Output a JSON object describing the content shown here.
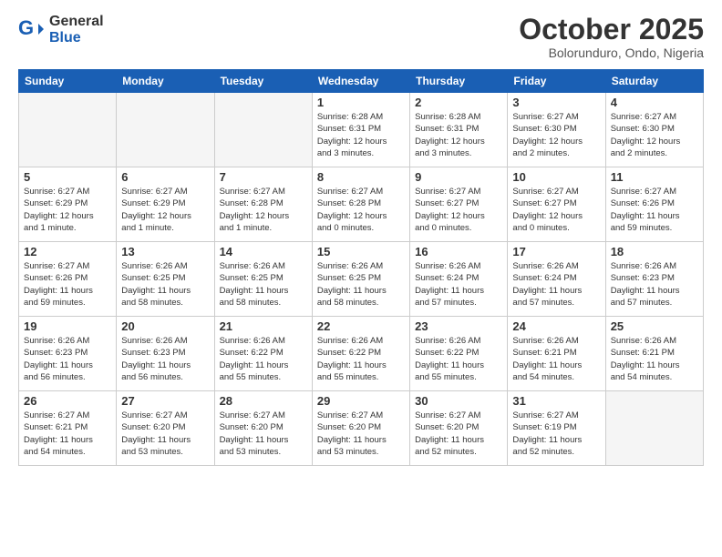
{
  "header": {
    "logo_general": "General",
    "logo_blue": "Blue",
    "month_title": "October 2025",
    "subtitle": "Bolorunduro, Ondo, Nigeria"
  },
  "calendar": {
    "days_of_week": [
      "Sunday",
      "Monday",
      "Tuesday",
      "Wednesday",
      "Thursday",
      "Friday",
      "Saturday"
    ],
    "weeks": [
      [
        {
          "day": "",
          "info": ""
        },
        {
          "day": "",
          "info": ""
        },
        {
          "day": "",
          "info": ""
        },
        {
          "day": "1",
          "info": "Sunrise: 6:28 AM\nSunset: 6:31 PM\nDaylight: 12 hours\nand 3 minutes."
        },
        {
          "day": "2",
          "info": "Sunrise: 6:28 AM\nSunset: 6:31 PM\nDaylight: 12 hours\nand 3 minutes."
        },
        {
          "day": "3",
          "info": "Sunrise: 6:27 AM\nSunset: 6:30 PM\nDaylight: 12 hours\nand 2 minutes."
        },
        {
          "day": "4",
          "info": "Sunrise: 6:27 AM\nSunset: 6:30 PM\nDaylight: 12 hours\nand 2 minutes."
        }
      ],
      [
        {
          "day": "5",
          "info": "Sunrise: 6:27 AM\nSunset: 6:29 PM\nDaylight: 12 hours\nand 1 minute."
        },
        {
          "day": "6",
          "info": "Sunrise: 6:27 AM\nSunset: 6:29 PM\nDaylight: 12 hours\nand 1 minute."
        },
        {
          "day": "7",
          "info": "Sunrise: 6:27 AM\nSunset: 6:28 PM\nDaylight: 12 hours\nand 1 minute."
        },
        {
          "day": "8",
          "info": "Sunrise: 6:27 AM\nSunset: 6:28 PM\nDaylight: 12 hours\nand 0 minutes."
        },
        {
          "day": "9",
          "info": "Sunrise: 6:27 AM\nSunset: 6:27 PM\nDaylight: 12 hours\nand 0 minutes."
        },
        {
          "day": "10",
          "info": "Sunrise: 6:27 AM\nSunset: 6:27 PM\nDaylight: 12 hours\nand 0 minutes."
        },
        {
          "day": "11",
          "info": "Sunrise: 6:27 AM\nSunset: 6:26 PM\nDaylight: 11 hours\nand 59 minutes."
        }
      ],
      [
        {
          "day": "12",
          "info": "Sunrise: 6:27 AM\nSunset: 6:26 PM\nDaylight: 11 hours\nand 59 minutes."
        },
        {
          "day": "13",
          "info": "Sunrise: 6:26 AM\nSunset: 6:25 PM\nDaylight: 11 hours\nand 58 minutes."
        },
        {
          "day": "14",
          "info": "Sunrise: 6:26 AM\nSunset: 6:25 PM\nDaylight: 11 hours\nand 58 minutes."
        },
        {
          "day": "15",
          "info": "Sunrise: 6:26 AM\nSunset: 6:25 PM\nDaylight: 11 hours\nand 58 minutes."
        },
        {
          "day": "16",
          "info": "Sunrise: 6:26 AM\nSunset: 6:24 PM\nDaylight: 11 hours\nand 57 minutes."
        },
        {
          "day": "17",
          "info": "Sunrise: 6:26 AM\nSunset: 6:24 PM\nDaylight: 11 hours\nand 57 minutes."
        },
        {
          "day": "18",
          "info": "Sunrise: 6:26 AM\nSunset: 6:23 PM\nDaylight: 11 hours\nand 57 minutes."
        }
      ],
      [
        {
          "day": "19",
          "info": "Sunrise: 6:26 AM\nSunset: 6:23 PM\nDaylight: 11 hours\nand 56 minutes."
        },
        {
          "day": "20",
          "info": "Sunrise: 6:26 AM\nSunset: 6:23 PM\nDaylight: 11 hours\nand 56 minutes."
        },
        {
          "day": "21",
          "info": "Sunrise: 6:26 AM\nSunset: 6:22 PM\nDaylight: 11 hours\nand 55 minutes."
        },
        {
          "day": "22",
          "info": "Sunrise: 6:26 AM\nSunset: 6:22 PM\nDaylight: 11 hours\nand 55 minutes."
        },
        {
          "day": "23",
          "info": "Sunrise: 6:26 AM\nSunset: 6:22 PM\nDaylight: 11 hours\nand 55 minutes."
        },
        {
          "day": "24",
          "info": "Sunrise: 6:26 AM\nSunset: 6:21 PM\nDaylight: 11 hours\nand 54 minutes."
        },
        {
          "day": "25",
          "info": "Sunrise: 6:26 AM\nSunset: 6:21 PM\nDaylight: 11 hours\nand 54 minutes."
        }
      ],
      [
        {
          "day": "26",
          "info": "Sunrise: 6:27 AM\nSunset: 6:21 PM\nDaylight: 11 hours\nand 54 minutes."
        },
        {
          "day": "27",
          "info": "Sunrise: 6:27 AM\nSunset: 6:20 PM\nDaylight: 11 hours\nand 53 minutes."
        },
        {
          "day": "28",
          "info": "Sunrise: 6:27 AM\nSunset: 6:20 PM\nDaylight: 11 hours\nand 53 minutes."
        },
        {
          "day": "29",
          "info": "Sunrise: 6:27 AM\nSunset: 6:20 PM\nDaylight: 11 hours\nand 53 minutes."
        },
        {
          "day": "30",
          "info": "Sunrise: 6:27 AM\nSunset: 6:20 PM\nDaylight: 11 hours\nand 52 minutes."
        },
        {
          "day": "31",
          "info": "Sunrise: 6:27 AM\nSunset: 6:19 PM\nDaylight: 11 hours\nand 52 minutes."
        },
        {
          "day": "",
          "info": ""
        }
      ]
    ]
  }
}
